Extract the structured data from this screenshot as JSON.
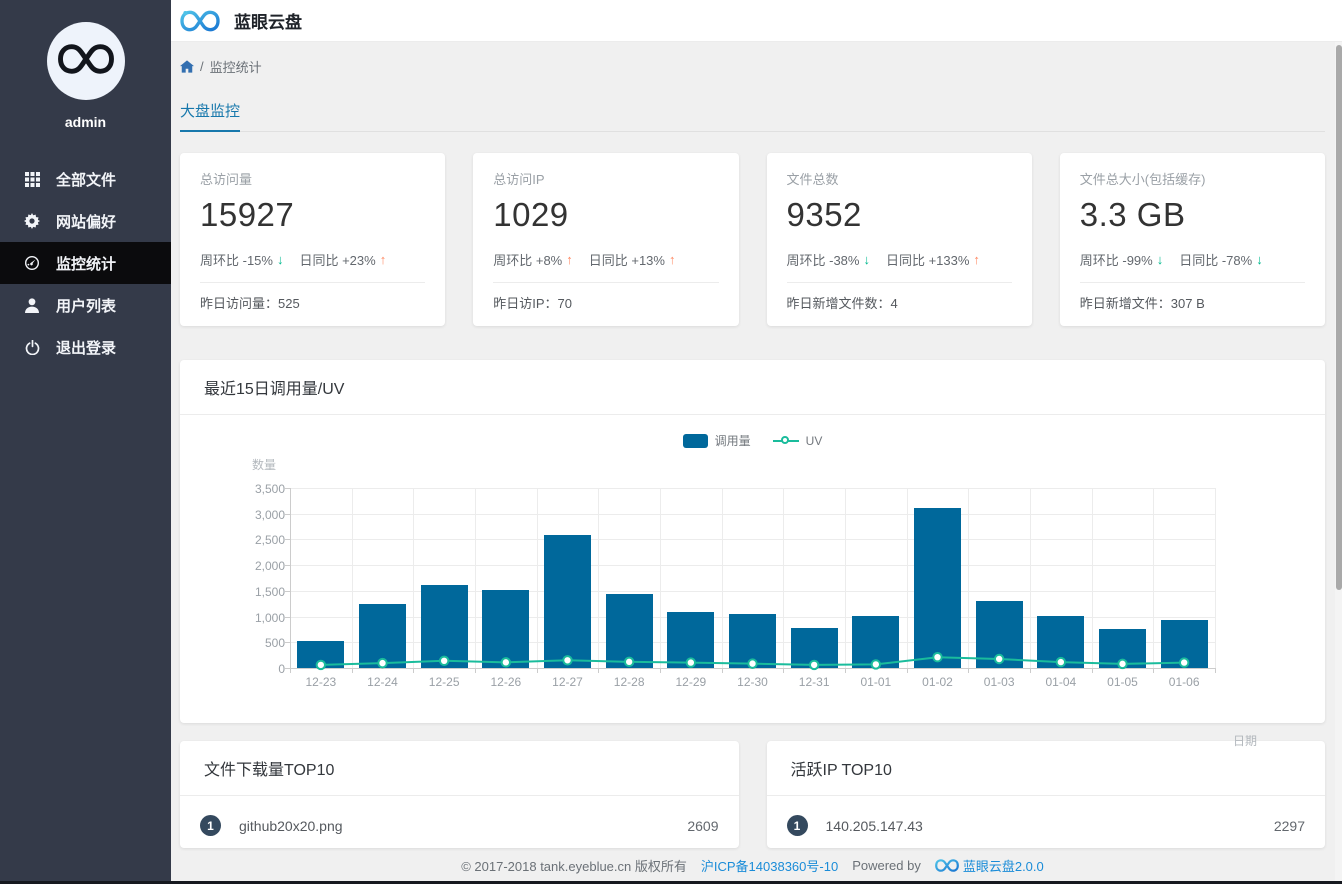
{
  "app": {
    "title": "蓝眼云盘"
  },
  "sidebar": {
    "username": "admin",
    "items": [
      {
        "label": "全部文件",
        "icon": "grid-icon",
        "active": false
      },
      {
        "label": "网站偏好",
        "icon": "gear-icon",
        "active": false
      },
      {
        "label": "监控统计",
        "icon": "dashboard-icon",
        "active": true
      },
      {
        "label": "用户列表",
        "icon": "user-icon",
        "active": false
      },
      {
        "label": "退出登录",
        "icon": "power-icon",
        "active": false
      }
    ]
  },
  "breadcrumb": {
    "separator": "/",
    "current": "监控统计"
  },
  "tabs": {
    "active_label": "大盘监控"
  },
  "stat_cards": [
    {
      "title": "总访问量",
      "value": "15927",
      "trends": [
        {
          "text": "周环比 -15%",
          "dir": "down"
        },
        {
          "text": "日同比 +23%",
          "dir": "up"
        }
      ],
      "footer_label": "昨日访问量：",
      "footer_value": "525"
    },
    {
      "title": "总访问IP",
      "value": "1029",
      "trends": [
        {
          "text": "周环比 +8%",
          "dir": "up"
        },
        {
          "text": "日同比 +13%",
          "dir": "up"
        }
      ],
      "footer_label": "昨日访IP：",
      "footer_value": "70"
    },
    {
      "title": "文件总数",
      "value": "9352",
      "trends": [
        {
          "text": "周环比 -38%",
          "dir": "down"
        },
        {
          "text": "日同比 +133%",
          "dir": "up"
        }
      ],
      "footer_label": "昨日新增文件数：",
      "footer_value": "4"
    },
    {
      "title": "文件总大小(包括缓存)",
      "value": "3.3 GB",
      "trends": [
        {
          "text": "周环比 -99%",
          "dir": "down"
        },
        {
          "text": "日同比 -78%",
          "dir": "down"
        }
      ],
      "footer_label": "昨日新增文件：",
      "footer_value": "307 B"
    }
  ],
  "chart_data": {
    "type": "bar",
    "title": "最近15日调用量/UV",
    "categories": [
      "12-23",
      "12-24",
      "12-25",
      "12-26",
      "12-27",
      "12-28",
      "12-29",
      "12-30",
      "12-31",
      "01-01",
      "01-02",
      "01-03",
      "01-04",
      "01-05",
      "01-06"
    ],
    "series": [
      {
        "name": "调用量",
        "type": "bar",
        "color": "#00689b",
        "values": [
          520,
          1250,
          1620,
          1520,
          2590,
          1440,
          1090,
          1060,
          780,
          1010,
          3110,
          1310,
          1010,
          750,
          930
        ]
      },
      {
        "name": "UV",
        "type": "line",
        "color": "#1abc9c",
        "values": [
          60,
          95,
          140,
          110,
          150,
          120,
          105,
          85,
          60,
          70,
          210,
          175,
          115,
          80,
          105
        ]
      }
    ],
    "xlabel": "日期",
    "ylabel": "数量",
    "ylim": [
      0,
      3500
    ],
    "ytick_step": 500,
    "grid": true,
    "legend_position": "top-center"
  },
  "top_lists": [
    {
      "title": "文件下载量TOP10",
      "rows": [
        {
          "rank": "1",
          "name": "github20x20.png",
          "value": "2609"
        }
      ]
    },
    {
      "title": "活跃IP TOP10",
      "rows": [
        {
          "rank": "1",
          "name": "140.205.147.43",
          "value": "2297"
        }
      ]
    }
  ],
  "footer": {
    "copyright": "© 2017-2018 tank.eyeblue.cn 版权所有",
    "icp_link": "沪ICP备14038360号-10",
    "powered_by": "Powered by",
    "product_link": "蓝眼云盘2.0.0"
  },
  "colors": {
    "sidebar_bg": "#343a49",
    "sidebar_active_bg": "#0b0b0d",
    "bar": "#00689b",
    "line": "#1abc9c",
    "trend_up": "#ff8a65",
    "trend_down": "#00b98e",
    "tab_blue": "#1778ac",
    "link_blue": "#1a8cd8",
    "badge": "#34495e"
  }
}
